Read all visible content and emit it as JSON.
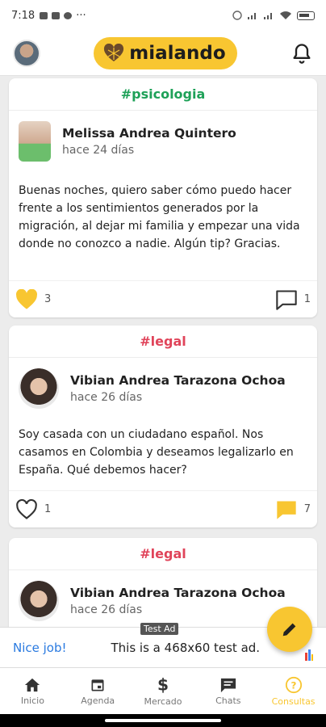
{
  "statusbar": {
    "time": "7:18",
    "more": "···"
  },
  "app": {
    "name": "mialando",
    "accent": "#f8c631"
  },
  "posts": [
    {
      "tag": "#psicologia",
      "tag_color": "#1ea158",
      "author": "Melissa Andrea Quintero",
      "time": "hace 24 días",
      "body": "Buenas noches, quiero saber cómo puedo hacer frente a los sentimientos generados por la migración, al dejar mi familia y empezar una vida donde no conozco a nadie. Algún tip? Gracias.",
      "likes": "3",
      "liked": true,
      "comments": "1",
      "commented": false
    },
    {
      "tag": "#legal",
      "tag_color": "#e0445a",
      "author": "Vibian Andrea Tarazona Ochoa",
      "time": "hace 26 días",
      "body": "Soy casada con un ciudadano español.  Nos casamos en Colombia y deseamos legalizarlo en España.   Qué debemos hacer?",
      "likes": "1",
      "liked": false,
      "comments": "7",
      "commented": true
    },
    {
      "tag": "#legal",
      "tag_color": "#e0445a",
      "author": "Vibian Andrea Tarazona Ochoa",
      "time": "hace 26 días"
    }
  ],
  "ad": {
    "nice": "Nice job!",
    "text": "This is a 468x60 test ad.",
    "label": "Test Ad"
  },
  "nav": [
    {
      "label": "Inicio",
      "icon": "home-icon"
    },
    {
      "label": "Agenda",
      "icon": "calendar-icon"
    },
    {
      "label": "Mercado",
      "icon": "dollar-icon"
    },
    {
      "label": "Chats",
      "icon": "chat-icon"
    },
    {
      "label": "Consultas",
      "icon": "help-circle-icon",
      "active": true
    }
  ]
}
